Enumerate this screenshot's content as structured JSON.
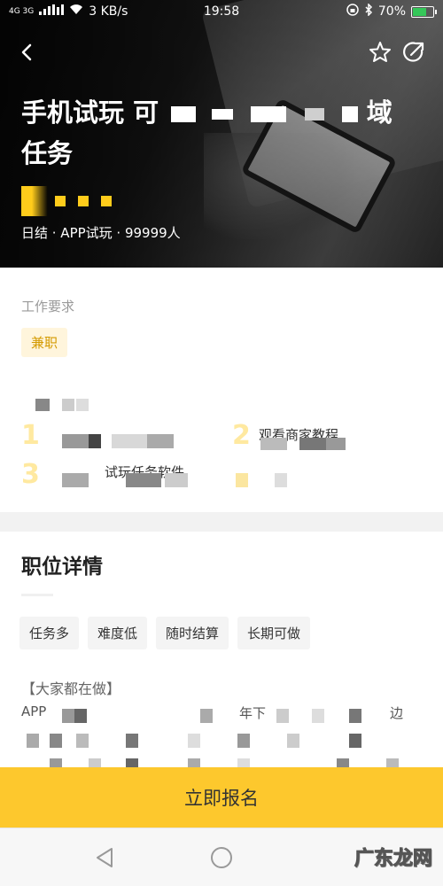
{
  "status_bar": {
    "signal": "4G 3G",
    "speed": "3 KB/s",
    "time": "19:58",
    "battery": "70%",
    "battery_level": 0.7
  },
  "header": {
    "title_line1": "手机试玩 可",
    "title_line1_end": "域",
    "title_line2": "任务",
    "salary_digit": "5",
    "meta": "日结 · APP试玩 · 99999人"
  },
  "requirements": {
    "label": "工作要求",
    "tag": "兼职",
    "step2_text": "观看商家教程",
    "step3_text": "试玩任务软件",
    "step_numbers": [
      "1",
      "2",
      "3"
    ]
  },
  "details": {
    "title": "职位详情",
    "chips": [
      "任务多",
      "难度低",
      "随时结算",
      "长期可做"
    ],
    "everyone_doing": "【大家都在做】",
    "line1_start": "APP",
    "line1_mid": "年下",
    "line1_end": "边"
  },
  "cta": {
    "label": "立即报名"
  },
  "watermark": "广东龙网",
  "colors": {
    "accent": "#fdc82d",
    "tag_bg": "#fff5dc",
    "tag_text": "#d49a00"
  }
}
